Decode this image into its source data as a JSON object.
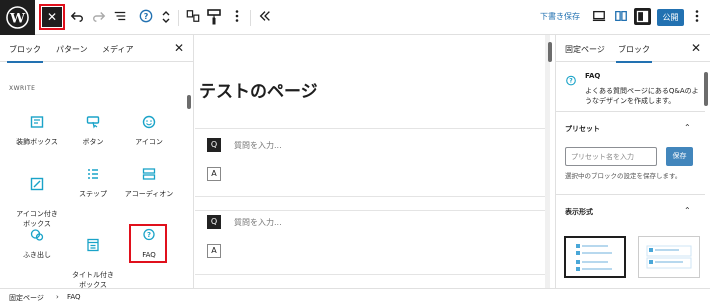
{
  "toolbar": {
    "close_symbol": "✕",
    "save_draft_label": "下書き保存",
    "publish_label": "公開",
    "accent_color": "#2271b1",
    "highlight_color": "#e0101c"
  },
  "inserter": {
    "tabs": [
      {
        "label": "ブロック",
        "active": true
      },
      {
        "label": "パターン",
        "active": false
      },
      {
        "label": "メディア",
        "active": false
      }
    ],
    "close_symbol": "✕",
    "category": "XWRITE",
    "blocks": [
      {
        "label": "装飾ボックス",
        "icon": "decorated-box-icon"
      },
      {
        "label": "ボタン",
        "icon": "button-icon"
      },
      {
        "label": "アイコン",
        "icon": "smiley-icon"
      },
      {
        "label": "アイコン付き\nボックス",
        "icon": "icon-box-icon"
      },
      {
        "label": "ステップ",
        "icon": "steps-icon"
      },
      {
        "label": "アコーディオン",
        "icon": "accordion-icon"
      },
      {
        "label": "ふき出し",
        "icon": "speech-bubble-icon"
      },
      {
        "label": "タイトル付き\nボックス",
        "icon": "titled-box-icon"
      },
      {
        "label": "FAQ",
        "icon": "faq-icon"
      }
    ]
  },
  "canvas": {
    "page_title": "テストのページ",
    "faq_items": [
      {
        "q_badge": "Q",
        "q_placeholder": "質問を入力...",
        "a_badge": "A"
      },
      {
        "q_badge": "Q",
        "q_placeholder": "質問を入力...",
        "a_badge": "A"
      }
    ]
  },
  "settings": {
    "tabs": [
      {
        "label": "固定ページ",
        "active": false
      },
      {
        "label": "ブロック",
        "active": true
      }
    ],
    "close_symbol": "✕",
    "block_name": "FAQ",
    "block_description": "よくある質問ページにあるQ&Aのようなデザインを作成します。",
    "preset_heading": "プリセット",
    "preset_placeholder": "プリセット名を入力",
    "preset_save_label": "保存",
    "preset_help": "選択中のブロックの設定を保存します。",
    "display_heading": "表示形式"
  },
  "breadcrumb": {
    "items": [
      "固定ページ",
      "FAQ"
    ],
    "separator": "›"
  }
}
